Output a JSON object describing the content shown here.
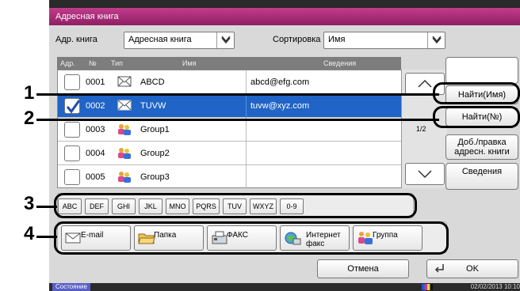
{
  "window": {
    "title": "Адресная книга"
  },
  "filters": {
    "book_label": "Адр. книга",
    "book_value": "Адресная книга",
    "sort_label": "Сортировка",
    "sort_value": "Имя"
  },
  "columns": {
    "addr": "Адр.",
    "num": "№",
    "type": "Тип",
    "name": "Имя",
    "details": "Сведения"
  },
  "rows": [
    {
      "num": "0001",
      "type": "envelope-icon",
      "name": "ABCD",
      "details": "abcd@efg.com",
      "checked": false
    },
    {
      "num": "0002",
      "type": "envelope-icon",
      "name": "TUVW",
      "details": "tuvw@xyz.com",
      "checked": true
    },
    {
      "num": "0003",
      "type": "group-icon",
      "name": "Group1",
      "details": "",
      "checked": false
    },
    {
      "num": "0004",
      "type": "group-icon",
      "name": "Group2",
      "details": "",
      "checked": false
    },
    {
      "num": "0005",
      "type": "group-icon",
      "name": "Group3",
      "details": "",
      "checked": false
    }
  ],
  "page_indicator": "1/2",
  "side_buttons": {
    "find_name": "Найти(Имя)",
    "find_num": "Найти(№)",
    "add_edit_line1": "Доб./правка",
    "add_edit_line2": "адресн. книги",
    "details": "Сведения"
  },
  "index_keys": [
    "ABC",
    "DEF",
    "GHI",
    "JKL",
    "MNO",
    "PQRS",
    "TUV",
    "WXYZ",
    "0-9"
  ],
  "categories": {
    "email": "E-mail",
    "folder": "Папка",
    "fax": "ФАКС",
    "ifax_line1": "Интернет",
    "ifax_line2": "факс",
    "group": "Группа"
  },
  "bottom": {
    "cancel": "Отмена",
    "ok": "OK"
  },
  "status": {
    "label": "Состояние",
    "datetime": "02/02/2013 10:10"
  },
  "callouts": [
    "1",
    "2",
    "3",
    "4"
  ],
  "colors": {
    "title_bar": "#b0327a",
    "selection": "#1f64c6"
  }
}
